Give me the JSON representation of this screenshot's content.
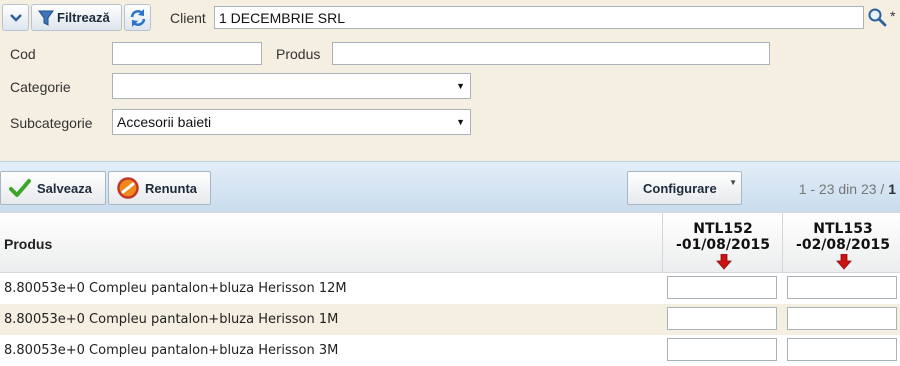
{
  "topbar": {
    "filter_label": "Filtrează",
    "client_label": "Client",
    "client_value": "1 DECEMBRIE SRL",
    "required_mark": "*"
  },
  "form": {
    "cod_label": "Cod",
    "cod_value": "",
    "produs_label": "Produs",
    "produs_value": "",
    "categorie_label": "Categorie",
    "categorie_value": "",
    "subcategorie_label": "Subcategorie",
    "subcategorie_value": "Accesorii baieti"
  },
  "toolbar": {
    "save_label": "Salveaza",
    "cancel_label": "Renunta",
    "config_label": "Configurare",
    "pager_range": "1 - 23 din 23 /",
    "pager_page": "1"
  },
  "grid": {
    "produs_header": "Produs",
    "columns": [
      {
        "line1": "NTL152",
        "line2": "-01/08/2015"
      },
      {
        "line1": "NTL153",
        "line2": "-02/08/2015"
      }
    ],
    "rows": [
      {
        "product": "8.80053e+0 Compleu pantalon+bluza Herisson 12M",
        "qty": [
          "",
          ""
        ]
      },
      {
        "product": "8.80053e+0 Compleu pantalon+bluza Herisson 1M",
        "qty": [
          "",
          ""
        ]
      },
      {
        "product": "8.80053e+0 Compleu pantalon+bluza Herisson 3M",
        "qty": [
          "",
          ""
        ]
      }
    ]
  },
  "colors": {
    "panel_bg": "#f5efe2",
    "toolbar_bg": "#c9dced",
    "arrow_red": "#cc1111",
    "save_green": "#3aa62a"
  }
}
